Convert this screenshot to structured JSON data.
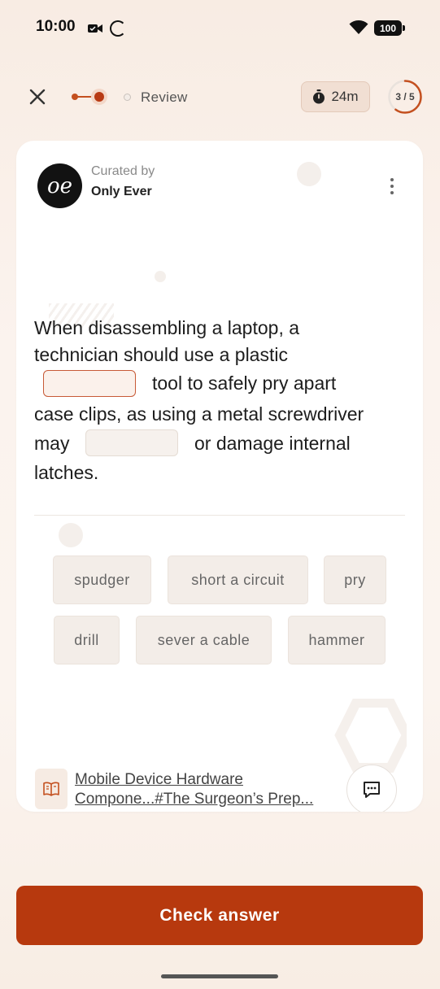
{
  "status_bar": {
    "time": "10:00",
    "battery": "100"
  },
  "header": {
    "review_label": "Review",
    "timer": "24m",
    "counter": "3 / 5",
    "progress_fraction": 0.6
  },
  "curator": {
    "label": "Curated by",
    "name": "Only Ever",
    "avatar_text": "oe"
  },
  "question": {
    "line1": "When disassembling a laptop, a",
    "line2": "technician should use a plastic",
    "line3": "tool to safely pry apart",
    "line4": "case clips, as using a metal screwdriver",
    "line5_start": "may",
    "line5_end": "or damage internal",
    "line6": "latches."
  },
  "options": [
    "spudger",
    "short a circuit",
    "pry",
    "drill",
    "sever a cable",
    "hammer"
  ],
  "source": {
    "line1": "Mobile Device Hardware",
    "line2": "Compone...#The Surgeon’s Prep..."
  },
  "actions": {
    "check_answer": "Check answer"
  },
  "colors": {
    "accent": "#b7390e",
    "blank_border": "#c75a37"
  }
}
